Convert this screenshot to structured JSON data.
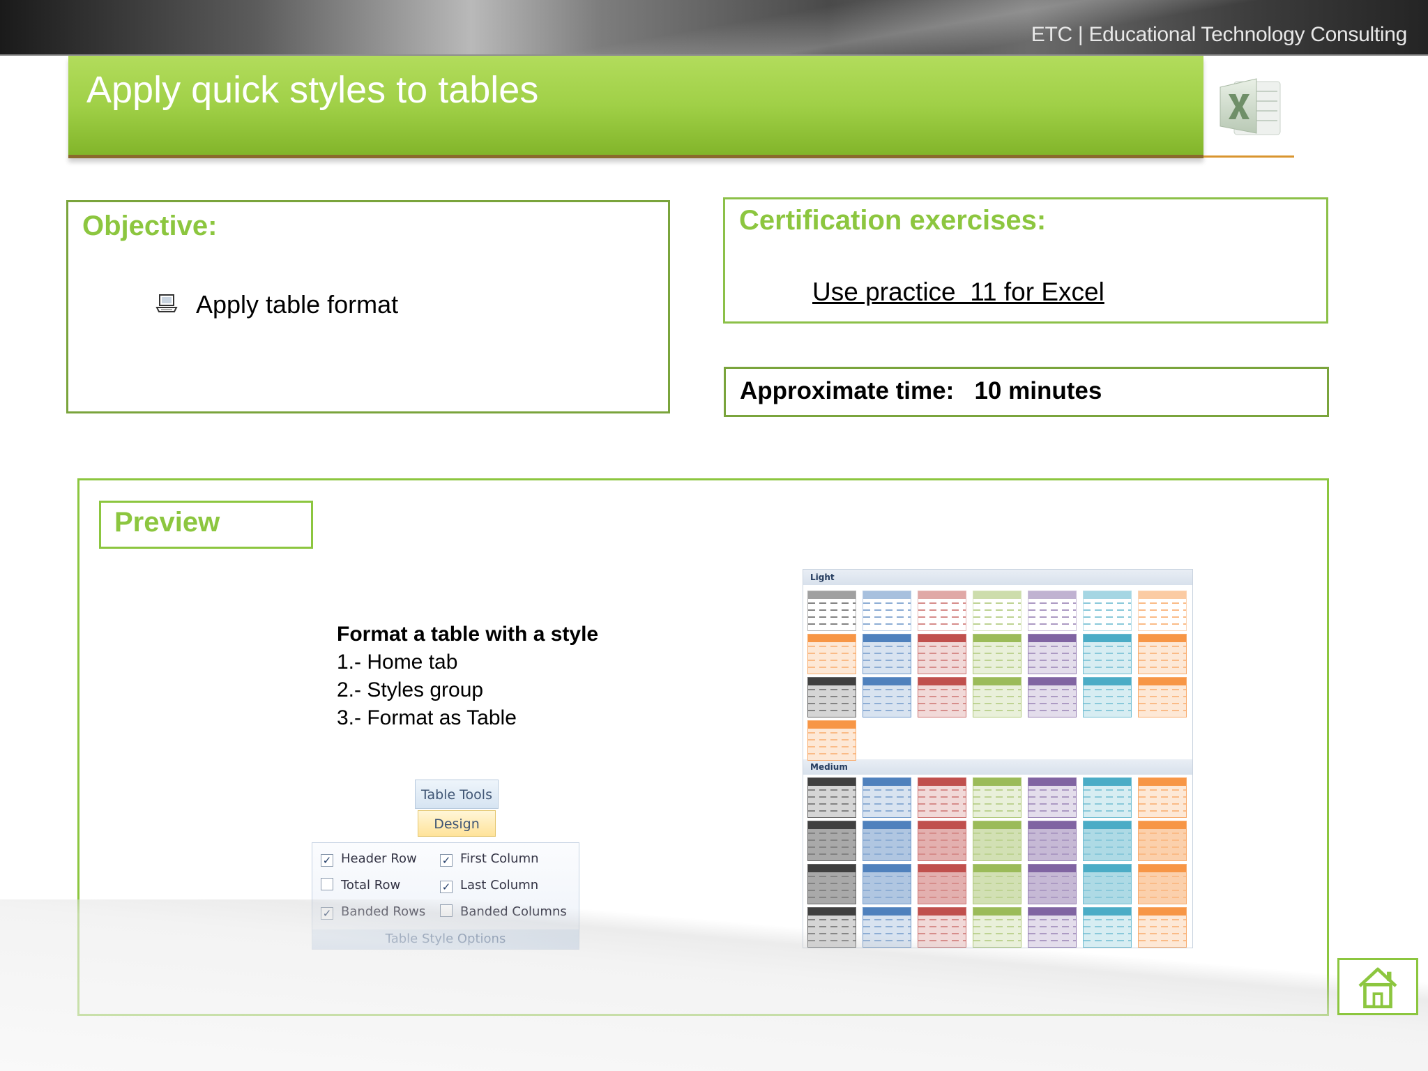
{
  "header": {
    "brand": "ETC | Educational Technology Consulting"
  },
  "slide": {
    "title": "Apply quick styles to tables"
  },
  "objective": {
    "heading": "Objective:",
    "item": "Apply table format"
  },
  "certification": {
    "heading": "Certification exercises:",
    "link": "Use practice  11 for Excel"
  },
  "time": {
    "text": "Approximate time:   10 minutes"
  },
  "preview": {
    "label": "Preview",
    "steps_title": "Format a table with a style",
    "steps": [
      "1.- Home tab",
      "2.- Styles group",
      "3.- Format as Table"
    ]
  },
  "ribbon": {
    "tab_context": "Table Tools",
    "tab_active": "Design",
    "options": [
      {
        "label": "Header Row",
        "checked": true
      },
      {
        "label": "First Column",
        "checked": true
      },
      {
        "label": "Total Row",
        "checked": false
      },
      {
        "label": "Last Column",
        "checked": true
      },
      {
        "label": "Banded Rows",
        "checked": true
      },
      {
        "label": "Banded Columns",
        "checked": false
      }
    ],
    "group_label": "Table Style Options"
  },
  "gallery": {
    "sections": [
      "Light",
      "Medium"
    ],
    "colors": [
      "#404040",
      "#4f81bd",
      "#c0504d",
      "#9bbb59",
      "#8064a2",
      "#4bacc6",
      "#f79646"
    ]
  },
  "icons": {
    "objective_bullet": "laptop-icon",
    "home": "home-icon",
    "app_logo": "excel-logo-icon"
  }
}
